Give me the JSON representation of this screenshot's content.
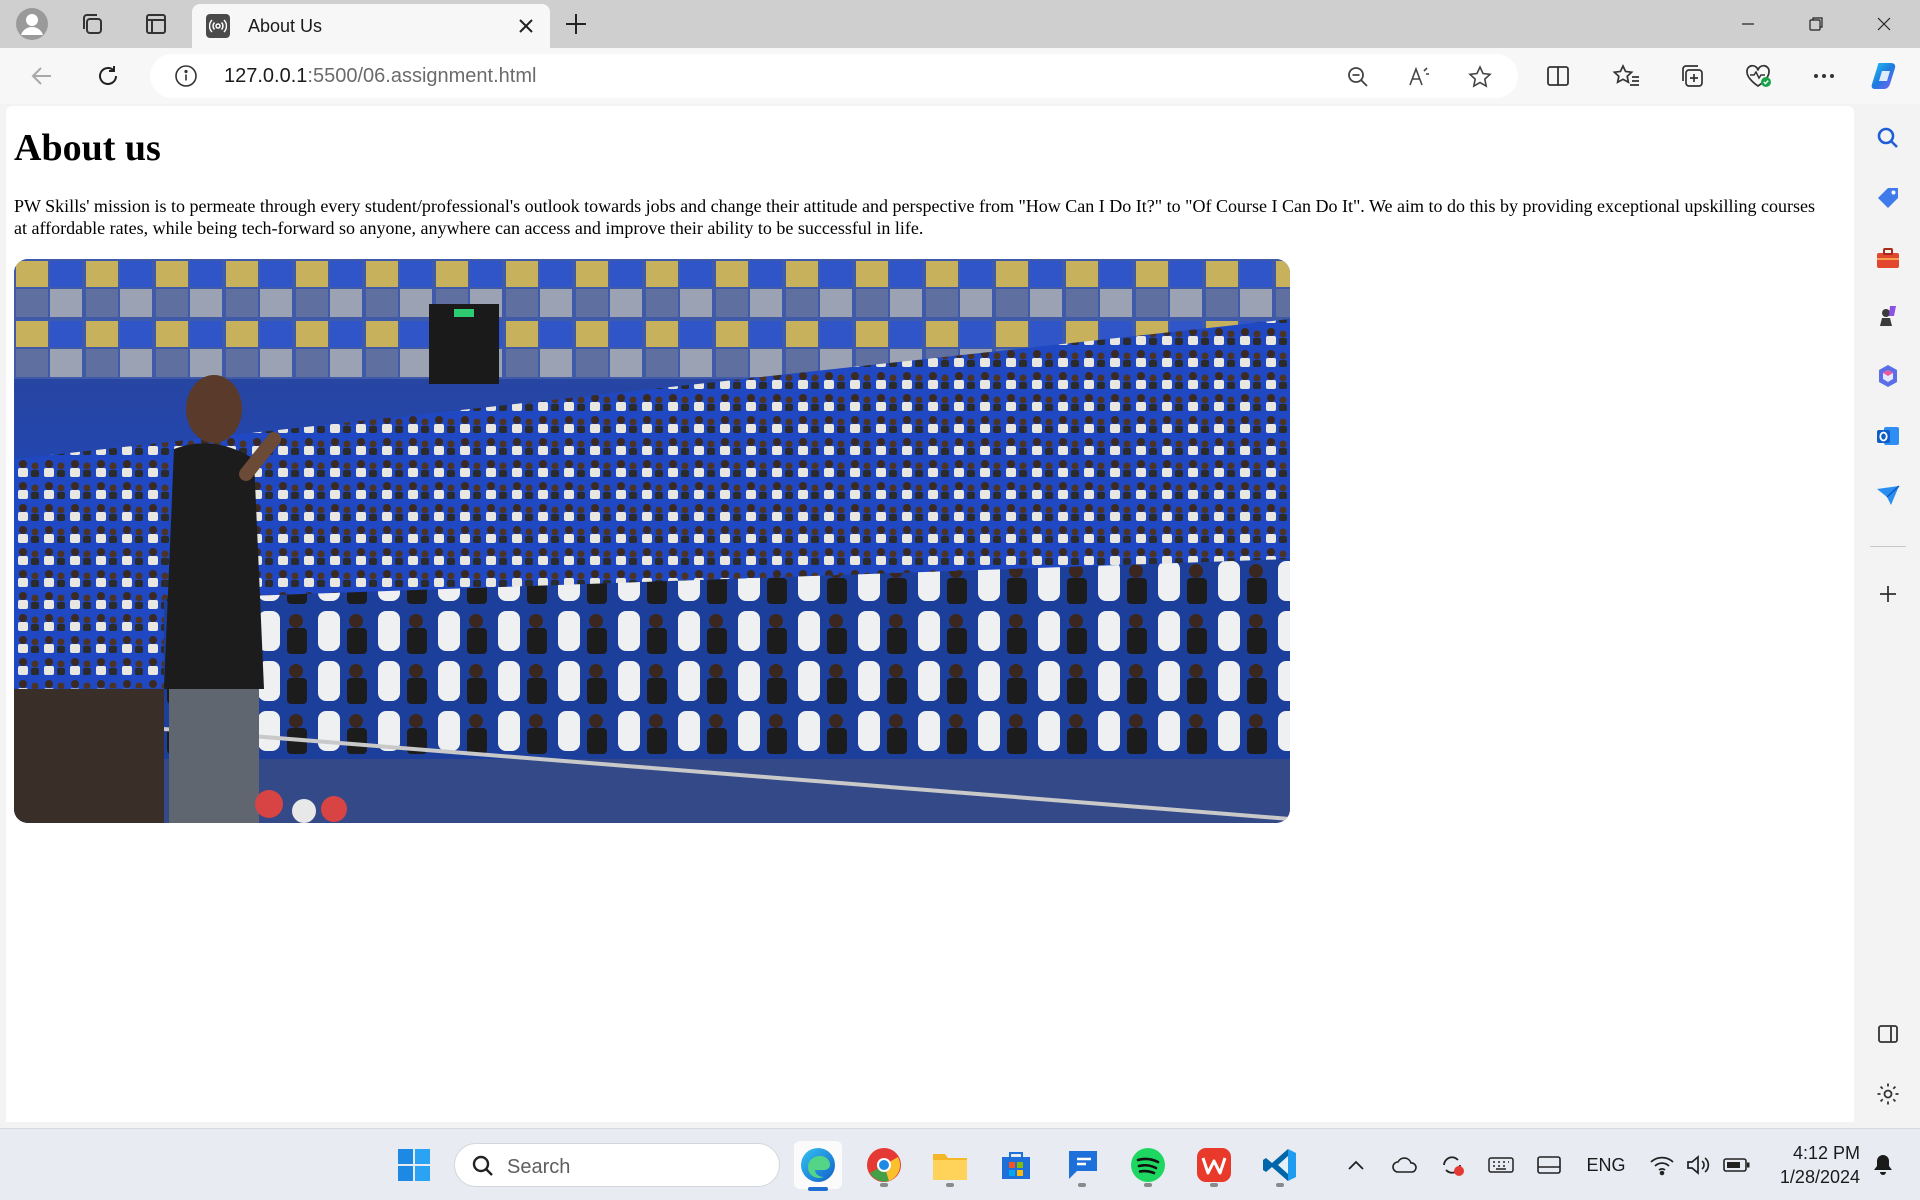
{
  "browser": {
    "tab_title": "About Us",
    "url_host": "127.0.0.1",
    "url_rest": ":5500/06.assignment.html"
  },
  "page": {
    "heading": "About us",
    "paragraph": "PW Skills' mission is to permeate through every student/professional's outlook towards jobs and change their attitude and perspective from \"How Can I Do It?\" to \"Of Course I Can Do It\". We aim to do this by providing exceptional upskilling courses at affordable rates, while being tech-forward so anyone, anywhere can access and improve their ability to be successful in life.",
    "image_semantic": "auditorium-crowd-photo"
  },
  "taskbar": {
    "search_placeholder": "Search",
    "language": "ENG",
    "time": "4:12 PM",
    "date": "1/28/2024"
  },
  "icons": {
    "titlebar": [
      "profile-icon",
      "workspaces-icon",
      "tab-actions-icon"
    ],
    "toolbar": [
      "back-icon",
      "refresh-icon",
      "info-icon",
      "zoom-out-icon",
      "read-aloud-icon",
      "favorite-star-icon",
      "split-screen-icon",
      "favorites-icon",
      "collections-icon",
      "browser-essentials-icon",
      "more-icon",
      "copilot-icon"
    ],
    "sidebar": [
      "search-icon",
      "shopping-icon",
      "tools-icon",
      "games-icon",
      "microsoft-365-icon",
      "outlook-icon",
      "drop-icon",
      "add-icon",
      "sidebar-layout-icon",
      "settings-icon"
    ]
  },
  "colors": {
    "accent": "#0078d4",
    "photo_seats": "#2046b8"
  }
}
